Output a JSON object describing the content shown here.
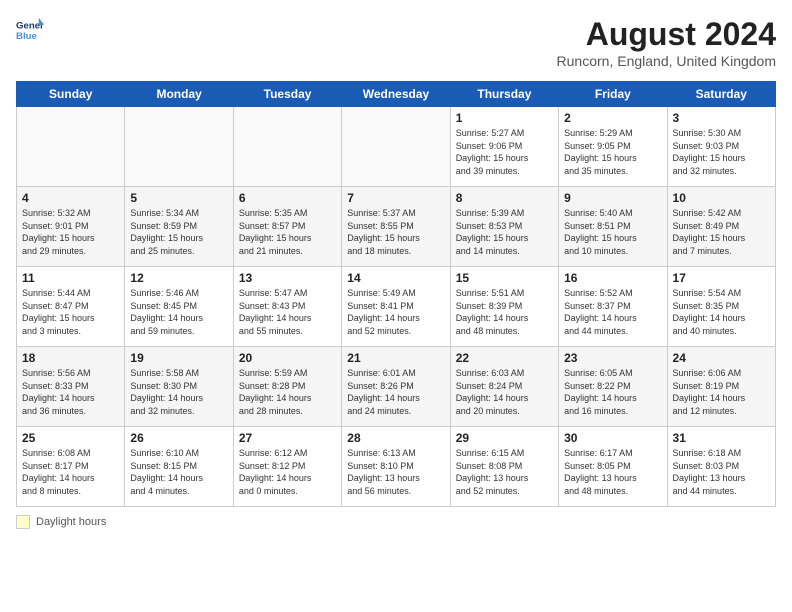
{
  "header": {
    "logo_line1": "General",
    "logo_line2": "Blue",
    "month_year": "August 2024",
    "location": "Runcorn, England, United Kingdom"
  },
  "weekdays": [
    "Sunday",
    "Monday",
    "Tuesday",
    "Wednesday",
    "Thursday",
    "Friday",
    "Saturday"
  ],
  "weeks": [
    [
      {
        "day": "",
        "info": ""
      },
      {
        "day": "",
        "info": ""
      },
      {
        "day": "",
        "info": ""
      },
      {
        "day": "",
        "info": ""
      },
      {
        "day": "1",
        "info": "Sunrise: 5:27 AM\nSunset: 9:06 PM\nDaylight: 15 hours\nand 39 minutes."
      },
      {
        "day": "2",
        "info": "Sunrise: 5:29 AM\nSunset: 9:05 PM\nDaylight: 15 hours\nand 35 minutes."
      },
      {
        "day": "3",
        "info": "Sunrise: 5:30 AM\nSunset: 9:03 PM\nDaylight: 15 hours\nand 32 minutes."
      }
    ],
    [
      {
        "day": "4",
        "info": "Sunrise: 5:32 AM\nSunset: 9:01 PM\nDaylight: 15 hours\nand 29 minutes."
      },
      {
        "day": "5",
        "info": "Sunrise: 5:34 AM\nSunset: 8:59 PM\nDaylight: 15 hours\nand 25 minutes."
      },
      {
        "day": "6",
        "info": "Sunrise: 5:35 AM\nSunset: 8:57 PM\nDaylight: 15 hours\nand 21 minutes."
      },
      {
        "day": "7",
        "info": "Sunrise: 5:37 AM\nSunset: 8:55 PM\nDaylight: 15 hours\nand 18 minutes."
      },
      {
        "day": "8",
        "info": "Sunrise: 5:39 AM\nSunset: 8:53 PM\nDaylight: 15 hours\nand 14 minutes."
      },
      {
        "day": "9",
        "info": "Sunrise: 5:40 AM\nSunset: 8:51 PM\nDaylight: 15 hours\nand 10 minutes."
      },
      {
        "day": "10",
        "info": "Sunrise: 5:42 AM\nSunset: 8:49 PM\nDaylight: 15 hours\nand 7 minutes."
      }
    ],
    [
      {
        "day": "11",
        "info": "Sunrise: 5:44 AM\nSunset: 8:47 PM\nDaylight: 15 hours\nand 3 minutes."
      },
      {
        "day": "12",
        "info": "Sunrise: 5:46 AM\nSunset: 8:45 PM\nDaylight: 14 hours\nand 59 minutes."
      },
      {
        "day": "13",
        "info": "Sunrise: 5:47 AM\nSunset: 8:43 PM\nDaylight: 14 hours\nand 55 minutes."
      },
      {
        "day": "14",
        "info": "Sunrise: 5:49 AM\nSunset: 8:41 PM\nDaylight: 14 hours\nand 52 minutes."
      },
      {
        "day": "15",
        "info": "Sunrise: 5:51 AM\nSunset: 8:39 PM\nDaylight: 14 hours\nand 48 minutes."
      },
      {
        "day": "16",
        "info": "Sunrise: 5:52 AM\nSunset: 8:37 PM\nDaylight: 14 hours\nand 44 minutes."
      },
      {
        "day": "17",
        "info": "Sunrise: 5:54 AM\nSunset: 8:35 PM\nDaylight: 14 hours\nand 40 minutes."
      }
    ],
    [
      {
        "day": "18",
        "info": "Sunrise: 5:56 AM\nSunset: 8:33 PM\nDaylight: 14 hours\nand 36 minutes."
      },
      {
        "day": "19",
        "info": "Sunrise: 5:58 AM\nSunset: 8:30 PM\nDaylight: 14 hours\nand 32 minutes."
      },
      {
        "day": "20",
        "info": "Sunrise: 5:59 AM\nSunset: 8:28 PM\nDaylight: 14 hours\nand 28 minutes."
      },
      {
        "day": "21",
        "info": "Sunrise: 6:01 AM\nSunset: 8:26 PM\nDaylight: 14 hours\nand 24 minutes."
      },
      {
        "day": "22",
        "info": "Sunrise: 6:03 AM\nSunset: 8:24 PM\nDaylight: 14 hours\nand 20 minutes."
      },
      {
        "day": "23",
        "info": "Sunrise: 6:05 AM\nSunset: 8:22 PM\nDaylight: 14 hours\nand 16 minutes."
      },
      {
        "day": "24",
        "info": "Sunrise: 6:06 AM\nSunset: 8:19 PM\nDaylight: 14 hours\nand 12 minutes."
      }
    ],
    [
      {
        "day": "25",
        "info": "Sunrise: 6:08 AM\nSunset: 8:17 PM\nDaylight: 14 hours\nand 8 minutes."
      },
      {
        "day": "26",
        "info": "Sunrise: 6:10 AM\nSunset: 8:15 PM\nDaylight: 14 hours\nand 4 minutes."
      },
      {
        "day": "27",
        "info": "Sunrise: 6:12 AM\nSunset: 8:12 PM\nDaylight: 14 hours\nand 0 minutes."
      },
      {
        "day": "28",
        "info": "Sunrise: 6:13 AM\nSunset: 8:10 PM\nDaylight: 13 hours\nand 56 minutes."
      },
      {
        "day": "29",
        "info": "Sunrise: 6:15 AM\nSunset: 8:08 PM\nDaylight: 13 hours\nand 52 minutes."
      },
      {
        "day": "30",
        "info": "Sunrise: 6:17 AM\nSunset: 8:05 PM\nDaylight: 13 hours\nand 48 minutes."
      },
      {
        "day": "31",
        "info": "Sunrise: 6:18 AM\nSunset: 8:03 PM\nDaylight: 13 hours\nand 44 minutes."
      }
    ]
  ],
  "footer": {
    "legend_label": "Daylight hours"
  }
}
